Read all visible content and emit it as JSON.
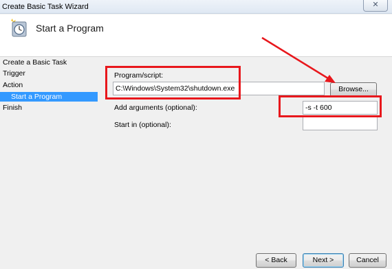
{
  "window": {
    "title": "Create Basic Task Wizard",
    "close_glyph": "✕"
  },
  "header": {
    "title": "Start a Program",
    "icon": "clock-task-icon"
  },
  "sidebar": {
    "items": [
      {
        "label": "Create a Basic Task",
        "active": false
      },
      {
        "label": "Trigger",
        "active": false
      },
      {
        "label": "Action",
        "active": false
      },
      {
        "label": "Start a Program",
        "active": true
      },
      {
        "label": "Finish",
        "active": false
      }
    ]
  },
  "form": {
    "program_label": "Program/script:",
    "program_value": "C:\\Windows\\System32\\shutdown.exe",
    "browse_label": "Browse...",
    "arguments_label": "Add arguments (optional):",
    "arguments_value": "-s -t 600",
    "start_in_label": "Start in (optional):",
    "start_in_value": ""
  },
  "footer": {
    "back_label": "< Back",
    "next_label": "Next >",
    "cancel_label": "Cancel"
  },
  "annotations": {
    "highlight_color": "#e8171c"
  }
}
